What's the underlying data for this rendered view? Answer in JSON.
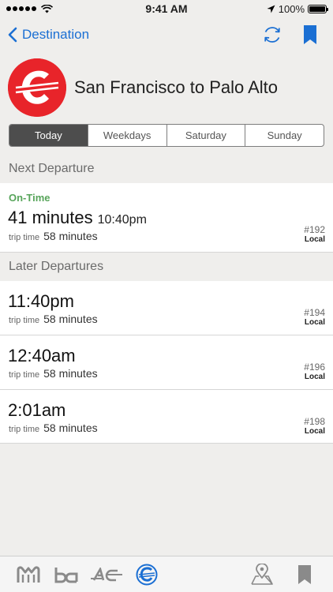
{
  "status_bar": {
    "time": "9:41 AM",
    "battery": "100%"
  },
  "nav": {
    "back_label": "Destination",
    "refresh_icon": "refresh-icon",
    "bookmark_icon": "bookmark-icon"
  },
  "header": {
    "title": "San Francisco to Palo Alto"
  },
  "segments": [
    {
      "label": "Today",
      "active": true
    },
    {
      "label": "Weekdays",
      "active": false
    },
    {
      "label": "Saturday",
      "active": false
    },
    {
      "label": "Sunday",
      "active": false
    }
  ],
  "next_departure": {
    "heading": "Next Departure",
    "status": "On-Time",
    "wait": "41 minutes",
    "time": "10:40pm",
    "trip_label": "trip time",
    "trip_duration": "58 minutes",
    "train": "#192",
    "type": "Local"
  },
  "later_departures": {
    "heading": "Later Departures",
    "items": [
      {
        "time": "11:40pm",
        "trip_label": "trip time",
        "trip_duration": "58 minutes",
        "train": "#194",
        "type": "Local"
      },
      {
        "time": "12:40am",
        "trip_label": "trip time",
        "trip_duration": "58 minutes",
        "train": "#196",
        "type": "Local"
      },
      {
        "time": "2:01am",
        "trip_label": "trip time",
        "trip_duration": "58 minutes",
        "train": "#198",
        "type": "Local"
      }
    ]
  },
  "tabs": {
    "muni": "muni-icon",
    "bart": "bart-icon",
    "ac": "ac-transit-icon",
    "caltrain": "caltrain-icon",
    "map": "map-pin-icon",
    "bookmarks": "bookmark-icon"
  },
  "colors": {
    "accent": "#1b6fd3",
    "brand_red": "#e8242a",
    "on_time": "#58a55b"
  }
}
